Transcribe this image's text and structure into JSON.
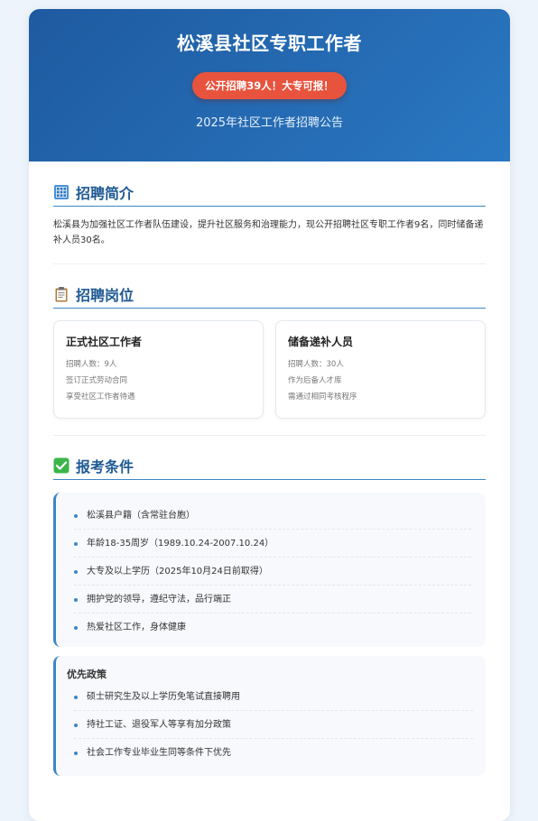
{
  "header": {
    "title": "松溪县社区专职工作者",
    "badge": "公开招聘39人！大专可报！",
    "subtitle": "2025年社区工作者招聘公告"
  },
  "intro": {
    "icon": "building-icon",
    "title": "招聘简介",
    "text": "松溪县为加强社区工作者队伍建设，提升社区服务和治理能力，现公开招聘社区专职工作者9名，同时储备递补人员30名。"
  },
  "positions": {
    "icon": "clipboard-icon",
    "title": "招聘岗位",
    "jobs": [
      {
        "name": "正式社区工作者",
        "lines": [
          "招聘人数：9人",
          "签订正式劳动合同",
          "享受社区工作者待遇"
        ]
      },
      {
        "name": "储备递补人员",
        "lines": [
          "招聘人数：30人",
          "作为后备人才库",
          "需通过相同考核程序"
        ]
      }
    ]
  },
  "requirements": {
    "icon": "check-icon",
    "title": "报考条件",
    "items": [
      "松溪县户籍（含常驻台胞）",
      "年龄18-35周岁（1989.10.24-2007.10.24）",
      "大专及以上学历（2025年10月24日前取得）",
      "拥护党的领导，遵纪守法，品行端正",
      "热爱社区工作，身体健康"
    ]
  },
  "policy": {
    "title": "优先政策",
    "items": [
      "硕士研究生及以上学历免笔试直接聘用",
      "持社工证、退役军人等享有加分政策",
      "社会工作专业毕业生同等条件下优先"
    ]
  },
  "colors": {
    "header_start": "#1e5aa0",
    "header_end": "#2a78c2",
    "badge": "#e8533e",
    "accent": "#3d86c6",
    "section_title": "#1f5a93",
    "check_green": "#3bb54a"
  }
}
